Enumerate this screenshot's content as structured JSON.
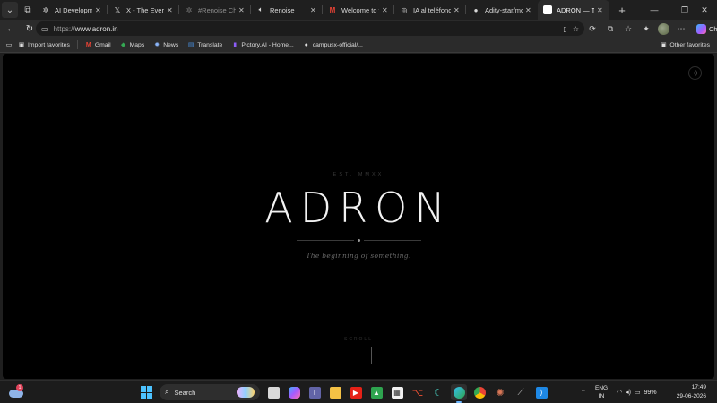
{
  "browser": {
    "tabs": [
      {
        "title": "AI Development P",
        "favicon": "settings-icon"
      },
      {
        "title": "X - The Everything",
        "favicon": "x-icon"
      },
      {
        "title": "#Renoise Challeng",
        "favicon": "renoise-icon",
        "dim": true
      },
      {
        "title": "Renoise",
        "favicon": "speaker-icon"
      },
      {
        "title": "Welcome to th",
        "favicon": "gmail-icon"
      },
      {
        "title": "IA al teléfono",
        "favicon": "globe-icon"
      },
      {
        "title": "Adity-star/mcp-yt",
        "favicon": "github-icon"
      },
      {
        "title": "ADRON — The be",
        "favicon": "adron-icon",
        "active": true
      }
    ],
    "address": {
      "protocol": "https://",
      "host": "www.adron.in"
    },
    "chat_label": "Chat",
    "favorites": [
      {
        "label": "Import favorites",
        "icon": "folder-icon"
      },
      {
        "label": "Gmail",
        "icon": "gmail-icon"
      },
      {
        "label": "Maps",
        "icon": "maps-icon"
      },
      {
        "label": "News",
        "icon": "news-icon"
      },
      {
        "label": "Translate",
        "icon": "translate-icon"
      },
      {
        "label": "Pictory.AI - Home...",
        "icon": "pictory-icon"
      },
      {
        "label": "campusx-official/...",
        "icon": "github-icon"
      }
    ],
    "other_favorites": "Other favorites"
  },
  "page": {
    "est": "EST. MMXX",
    "brand": "ADRON",
    "tagline": "The beginning of something.",
    "scroll_label": "SCROLL"
  },
  "taskbar": {
    "weather_badge": "1",
    "search_label": "Search",
    "lang_line1": "ENG",
    "lang_line2": "IN",
    "battery": "99%",
    "time": "17:49",
    "date": "29-06-2026"
  }
}
